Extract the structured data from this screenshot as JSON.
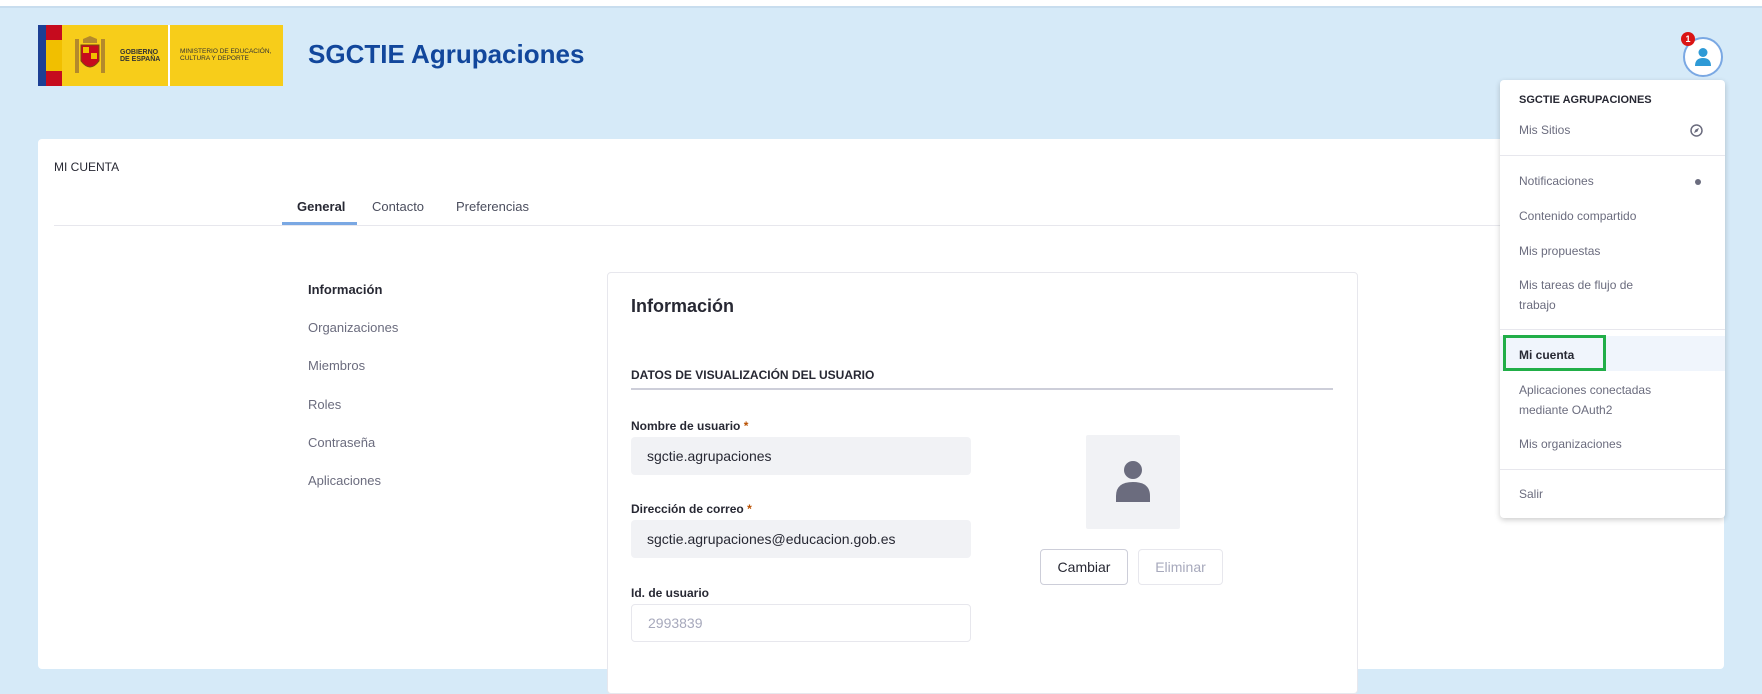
{
  "header": {
    "app_title": "SGCTIE Agrupaciones",
    "logo": {
      "gov_text": "GOBIERNO DE ESPAÑA",
      "ministry_text": "MINISTERIO DE EDUCACIÓN, CULTURA Y DEPORTE"
    },
    "notification_count": "1"
  },
  "page": {
    "title": "MI CUENTA",
    "tabs": [
      {
        "label": "General",
        "active": true
      },
      {
        "label": "Contacto"
      },
      {
        "label": "Preferencias"
      }
    ],
    "sidenav": [
      {
        "label": "Información",
        "active": true
      },
      {
        "label": "Organizaciones"
      },
      {
        "label": "Miembros"
      },
      {
        "label": "Roles"
      },
      {
        "label": "Contraseña"
      },
      {
        "label": "Aplicaciones"
      }
    ]
  },
  "panel": {
    "title": "Información",
    "section_title": "DATOS DE VISUALIZACIÓN DEL USUARIO",
    "fields": {
      "username_label": "Nombre de usuario",
      "username_value": "sgctie.agrupaciones",
      "email_label": "Dirección de correo",
      "email_value": "sgctie.agrupaciones@educacion.gob.es",
      "userid_label": "Id. de usuario",
      "userid_value": "2993839",
      "required_mark": "*"
    },
    "buttons": {
      "change": "Cambiar",
      "delete": "Eliminar"
    }
  },
  "user_menu": {
    "header": "SGCTIE AGRUPACIONES",
    "items": {
      "my_sites": "Mis Sitios",
      "notifications": "Notificaciones",
      "shared_content": "Contenido compartido",
      "my_proposals": "Mis propuestas",
      "workflow_tasks_1": "Mis tareas de flujo de",
      "workflow_tasks_2": "trabajo",
      "my_account": "Mi cuenta",
      "oauth_apps_1": "Aplicaciones conectadas",
      "oauth_apps_2": "mediante OAuth2",
      "my_orgs": "Mis organizaciones",
      "sign_out": "Salir"
    }
  },
  "colors": {
    "background": "#d6eaf8",
    "title_blue": "#12479c",
    "tab_accent": "#7aa8e3",
    "highlight_green": "#21ae48",
    "badge_red": "#da1414"
  }
}
